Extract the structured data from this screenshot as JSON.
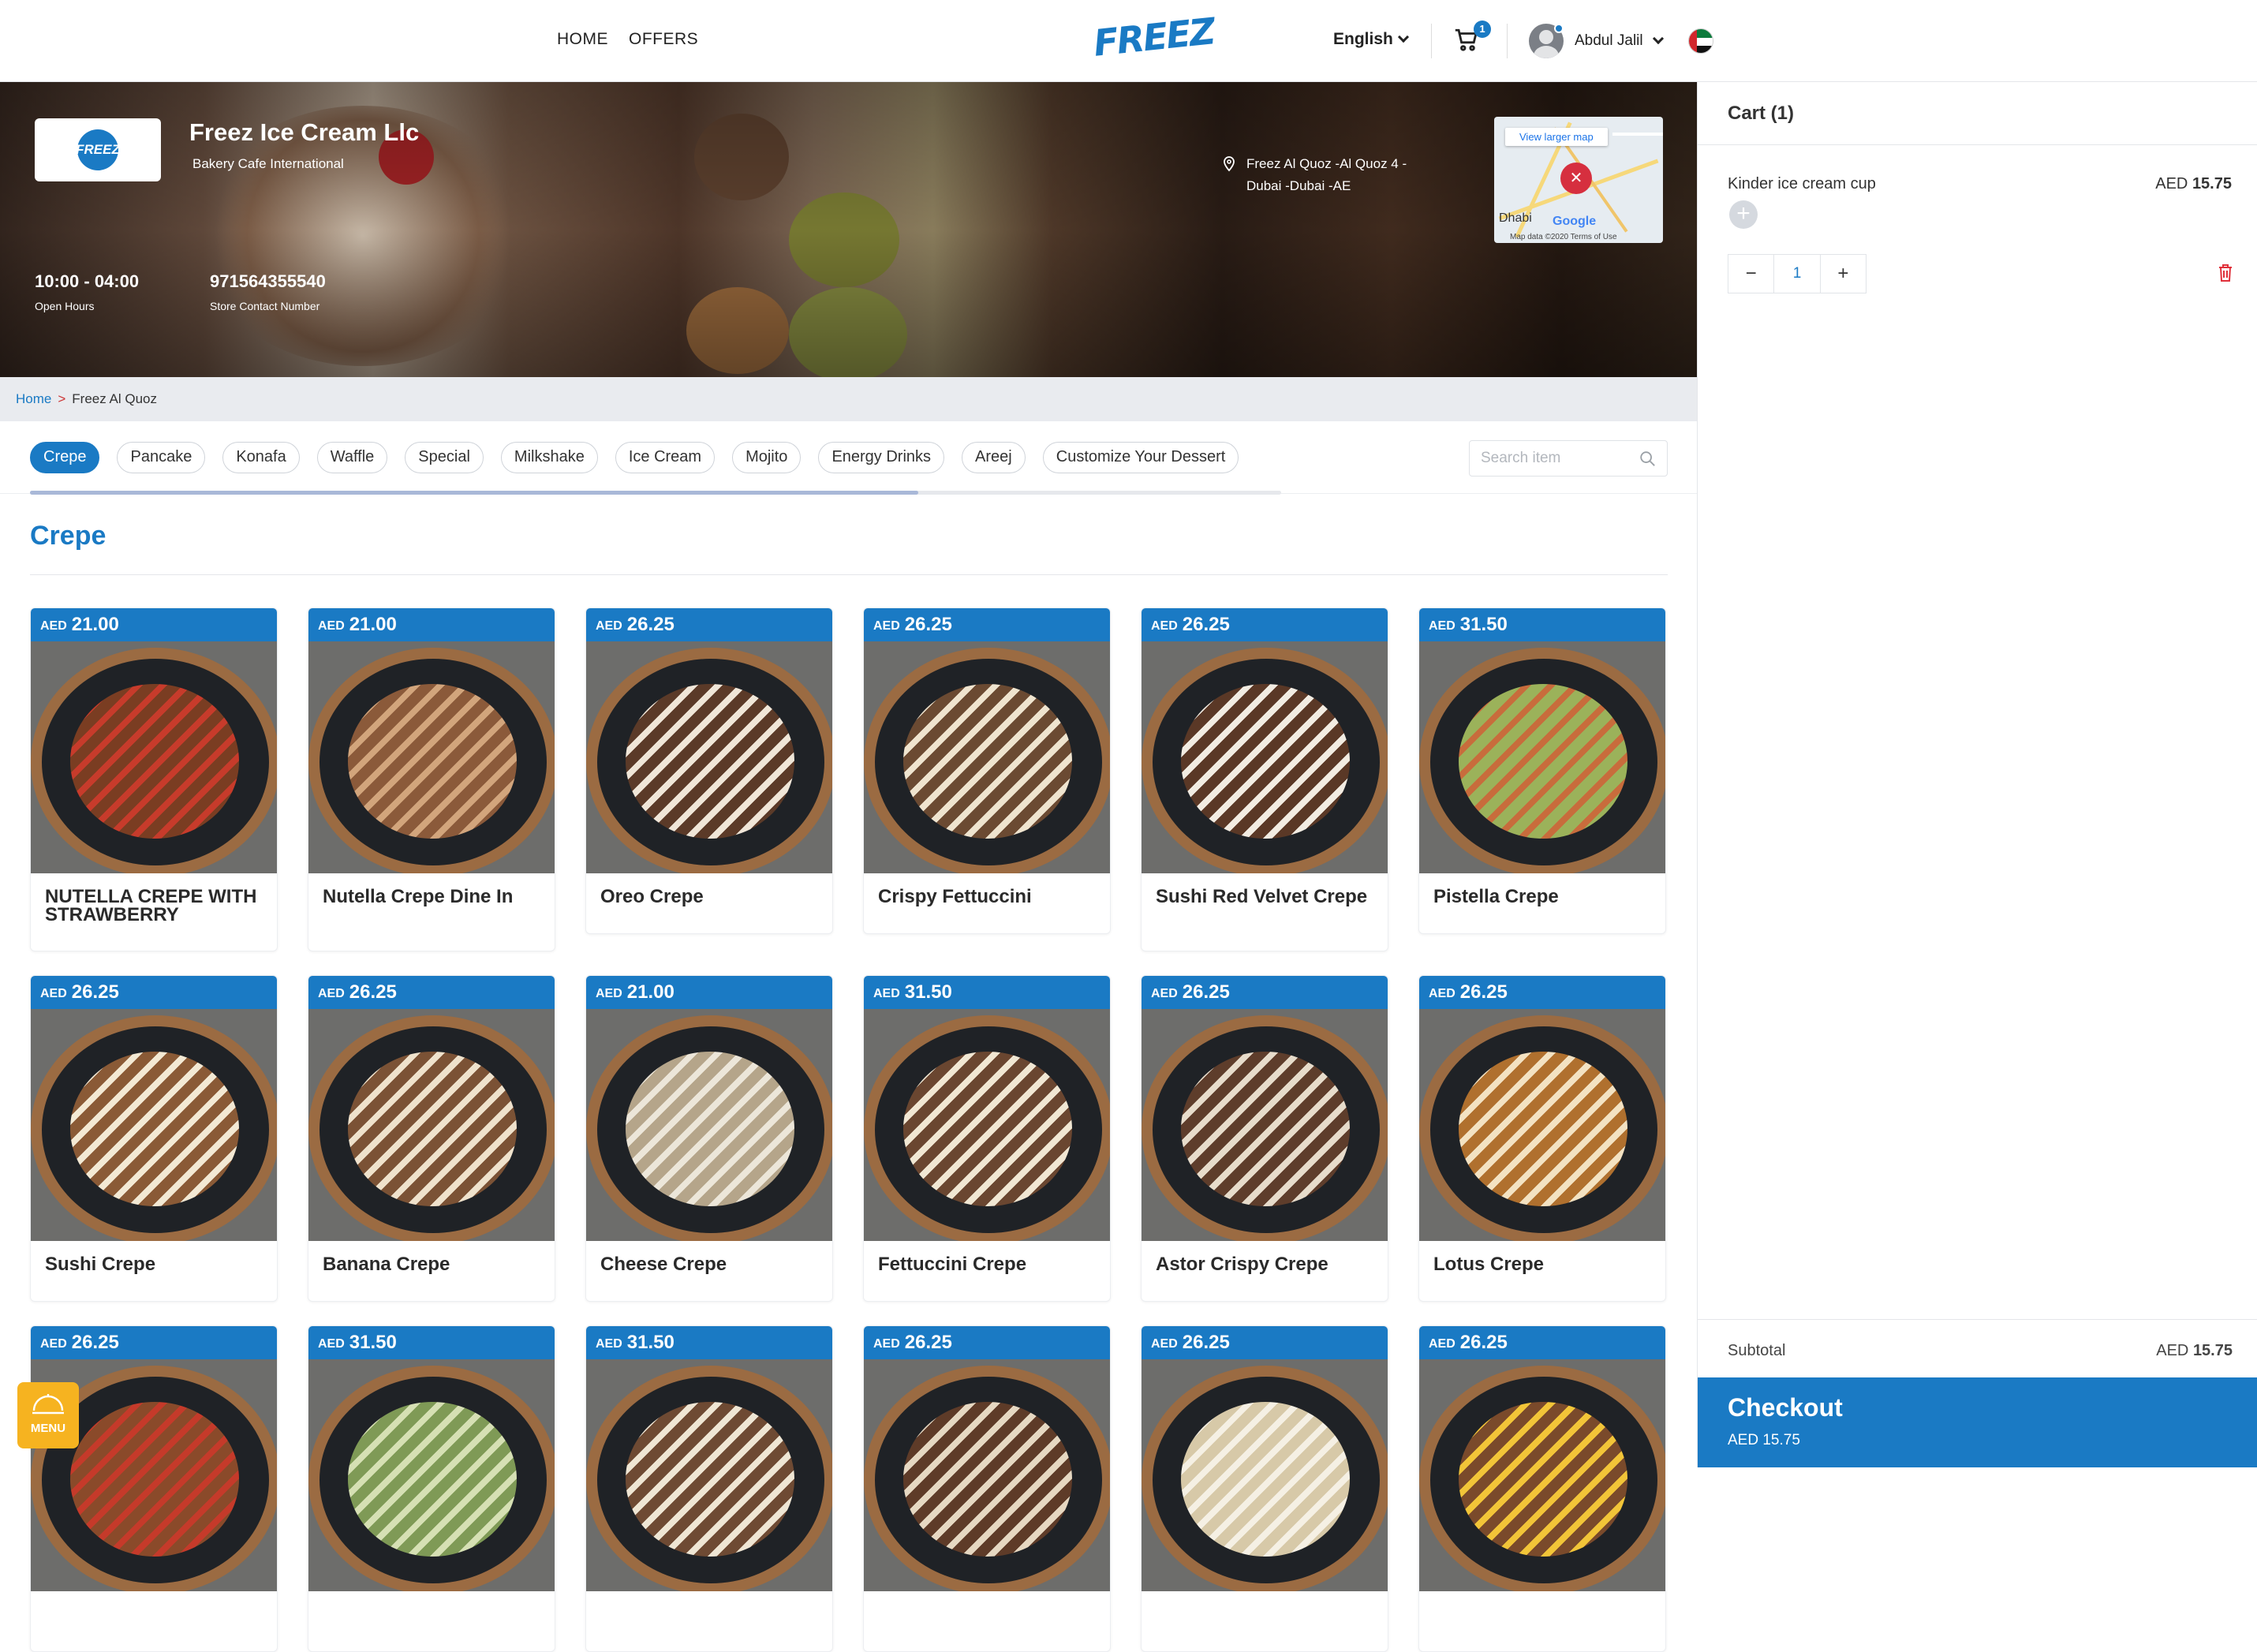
{
  "nav": {
    "links": [
      "HOME",
      "OFFERS"
    ],
    "logo": "FREEZ",
    "language": "English",
    "cart_count": "1",
    "user_name": "Abdul Jalil"
  },
  "store": {
    "logo_text": "FREEZ",
    "name": "Freez Ice Cream Llc",
    "subtitle": "Bakery Cafe International",
    "hours": "10:00 - 04:00",
    "hours_label": "Open Hours",
    "phone": "971564355540",
    "phone_label": "Store Contact Number",
    "address_line1": "Freez Al Quoz -Al Quoz 4 -",
    "address_line2": "Dubai -Dubai -AE"
  },
  "map": {
    "button": "View larger map",
    "city": "Dhabi",
    "brand": "Google",
    "footer": "Map data ©2020   Terms of Use"
  },
  "breadcrumb": {
    "home": "Home",
    "sep": ">",
    "current": "Freez Al Quoz"
  },
  "tabs": [
    "Crepe",
    "Pancake",
    "Konafa",
    "Waffle",
    "Special",
    "Milkshake",
    "Ice Cream",
    "Mojito",
    "Energy Drinks",
    "Areej",
    "Customize Your Dessert"
  ],
  "tab_scroll_fraction": 0.71,
  "search": {
    "placeholder": "Search item"
  },
  "section_title": "Crepe",
  "currency": "AED",
  "products": [
    {
      "price": "21.00",
      "name": "NUTELLA CREPE WITH STRAWBERRY"
    },
    {
      "price": "21.00",
      "name": "Nutella Crepe Dine In"
    },
    {
      "price": "26.25",
      "name": "Oreo Crepe"
    },
    {
      "price": "26.25",
      "name": "Crispy Fettuccini"
    },
    {
      "price": "26.25",
      "name": "Sushi Red Velvet Crepe"
    },
    {
      "price": "31.50",
      "name": "Pistella Crepe"
    },
    {
      "price": "26.25",
      "name": "Sushi Crepe"
    },
    {
      "price": "26.25",
      "name": "Banana Crepe"
    },
    {
      "price": "21.00",
      "name": "Cheese Crepe"
    },
    {
      "price": "31.50",
      "name": "Fettuccini Crepe"
    },
    {
      "price": "26.25",
      "name": "Astor Crispy Crepe"
    },
    {
      "price": "26.25",
      "name": "Lotus Crepe"
    },
    {
      "price": "26.25",
      "name": ""
    },
    {
      "price": "31.50",
      "name": ""
    },
    {
      "price": "31.50",
      "name": ""
    },
    {
      "price": "26.25",
      "name": ""
    },
    {
      "price": "26.25",
      "name": ""
    },
    {
      "price": "26.25",
      "name": ""
    }
  ],
  "cart": {
    "title": "Cart (1)",
    "item_name": "Kinder ice cream cup",
    "item_currency": "AED",
    "item_price": "15.75",
    "quantity": "1",
    "minus": "−",
    "plus": "+",
    "subtotal_label": "Subtotal",
    "subtotal_currency": "AED",
    "subtotal_value": "15.75",
    "checkout_label": "Checkout",
    "checkout_total": "AED 15.75"
  },
  "menu_fab": "MENU",
  "colors": {
    "brand_blue": "#1a7ac4",
    "menu_orange": "#f6b320",
    "delete_red": "#e0303a"
  }
}
